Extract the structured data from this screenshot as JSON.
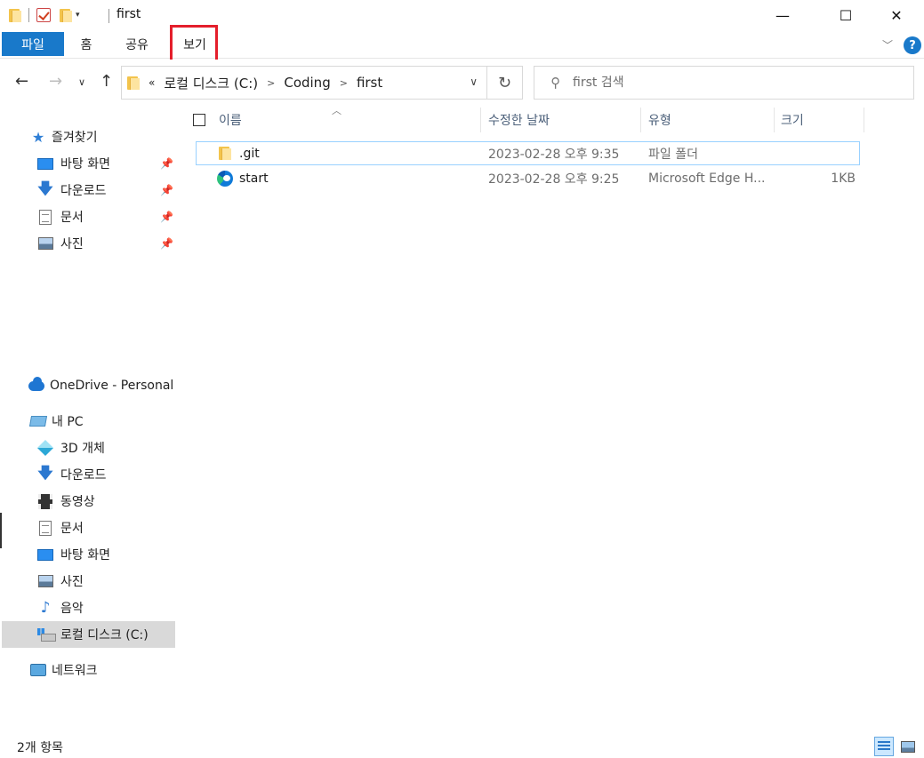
{
  "window": {
    "title": "first",
    "minimize_glyph": "—",
    "maximize_glyph": "☐",
    "close_glyph": "✕"
  },
  "ribbon": {
    "file_tab": "파일",
    "tabs": [
      "홈",
      "공유",
      "보기"
    ],
    "highlighted_tab": "보기",
    "highlight_color": "#e41e2b",
    "help_glyph": "?"
  },
  "address": {
    "overflow": "«",
    "crumbs": [
      "로컬 디스크 (C:)",
      "Coding",
      "first"
    ],
    "search_placeholder": "first 검색"
  },
  "nav": {
    "quick_access": "즐겨찾기",
    "quick_items": [
      "바탕 화면",
      "다운로드",
      "문서",
      "사진"
    ],
    "onedrive": "OneDrive - Personal",
    "this_pc": "내 PC",
    "pc_items": [
      "3D 개체",
      "다운로드",
      "동영상",
      "문서",
      "바탕 화면",
      "사진",
      "음악",
      "로컬 디스크 (C:)"
    ],
    "selected_item": "로컬 디스크 (C:)",
    "network": "네트워크"
  },
  "columns": {
    "name": "이름",
    "date": "수정한 날짜",
    "type": "유형",
    "size": "크기"
  },
  "files": [
    {
      "name": ".git",
      "date": "2023-02-28 오후 9:35",
      "type": "파일 폴더",
      "size": "",
      "icon": "folder-icon"
    },
    {
      "name": "start",
      "date": "2023-02-28 오후 9:25",
      "type": "Microsoft Edge H...",
      "size": "1KB",
      "icon": "edge-icon"
    }
  ],
  "status": {
    "item_count": "2개 항목"
  },
  "colors": {
    "accent": "#1979ca",
    "selection_border": "#99d1ff",
    "header_text": "#4c607a"
  }
}
